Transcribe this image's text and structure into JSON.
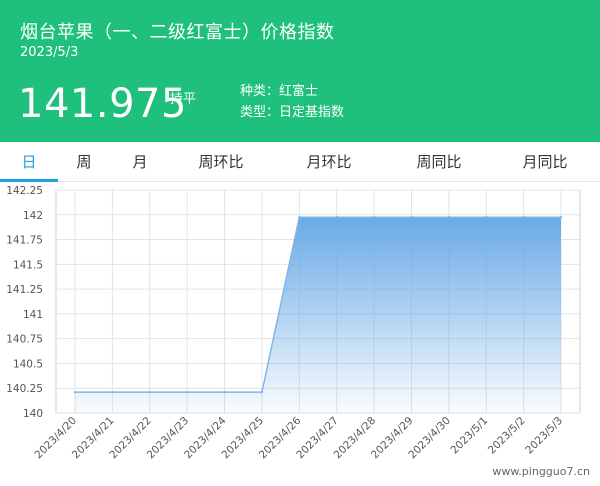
{
  "header": {
    "title": "烟台苹果（一、二级红富士）价格指数",
    "date": "2023/5/3",
    "price": "141.975",
    "trend": "持平",
    "kind_label": "种类：红富士",
    "type_label": "类型：日定基指数"
  },
  "tabs": [
    {
      "label": "日"
    },
    {
      "label": "周"
    },
    {
      "label": "月"
    },
    {
      "label": "周环比"
    },
    {
      "label": "月环比"
    },
    {
      "label": "周同比"
    },
    {
      "label": "月同比"
    }
  ],
  "colors": {
    "header_bg": "#1fc07c",
    "active_tab": "#1fa0e0",
    "series_line": "#7eb6e8",
    "area_top": "#6aaae6"
  },
  "chart_data": {
    "type": "area",
    "x": [
      "2023/4/20",
      "2023/4/21",
      "2023/4/22",
      "2023/4/23",
      "2023/4/24",
      "2023/4/25",
      "2023/4/26",
      "2023/4/27",
      "2023/4/28",
      "2023/4/29",
      "2023/4/30",
      "2023/5/1",
      "2023/5/2",
      "2023/5/3"
    ],
    "values": [
      140.21,
      140.21,
      140.21,
      140.21,
      140.21,
      140.21,
      141.975,
      141.975,
      141.975,
      141.975,
      141.975,
      141.975,
      141.975,
      141.975
    ],
    "yticks": [
      "142.25",
      "142",
      "141.75",
      "141.5",
      "141.25",
      "141",
      "140.75",
      "140.5",
      "140.25",
      "140"
    ],
    "ylim": [
      140,
      142.25
    ],
    "grid": true
  },
  "watermark": "www.pingguo7.cn"
}
